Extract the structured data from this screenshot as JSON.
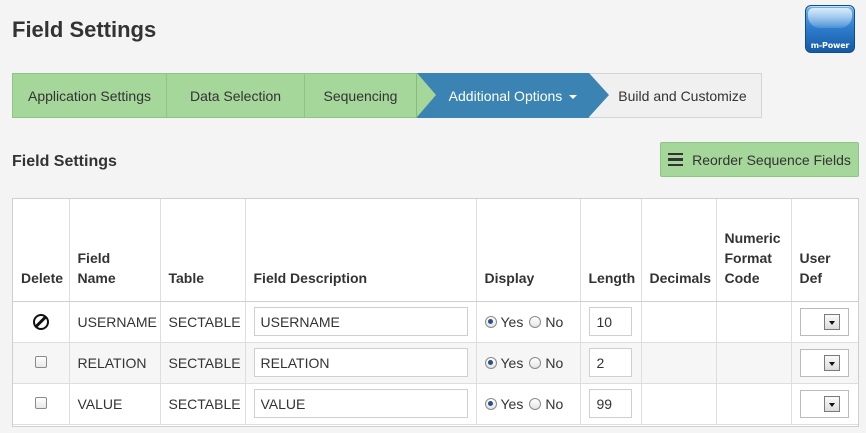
{
  "page": {
    "title": "Field Settings",
    "logo_text": "m-Power"
  },
  "wizard": {
    "steps": [
      {
        "label": "Application Settings",
        "state": "done"
      },
      {
        "label": "Data Selection",
        "state": "done"
      },
      {
        "label": "Sequencing",
        "state": "done"
      },
      {
        "label": "Additional Options",
        "state": "active"
      },
      {
        "label": "Build and Customize",
        "state": "todo"
      }
    ]
  },
  "section": {
    "title": "Field Settings",
    "reorder_label": "Reorder Sequence Fields"
  },
  "table": {
    "headers": {
      "delete": "Delete",
      "field_name": "Field Name",
      "table": "Table",
      "field_description": "Field Description",
      "display": "Display",
      "length": "Length",
      "decimals": "Decimals",
      "numeric_format": "Numeric Format Code",
      "user_def": "User Def"
    },
    "display_yes": "Yes",
    "display_no": "No",
    "rows": [
      {
        "delete": "disabled",
        "field_name": "USERNAME",
        "table": "SECTABLE",
        "description": "USERNAME",
        "display": "Yes",
        "length": "10",
        "decimals": "",
        "numeric_format": "",
        "user_def": ""
      },
      {
        "delete": "checkbox",
        "field_name": "RELATION",
        "table": "SECTABLE",
        "description": "RELATION",
        "display": "Yes",
        "length": "2",
        "decimals": "",
        "numeric_format": "",
        "user_def": ""
      },
      {
        "delete": "checkbox",
        "field_name": "VALUE",
        "table": "SECTABLE",
        "description": "VALUE",
        "display": "Yes",
        "length": "99",
        "decimals": "",
        "numeric_format": "",
        "user_def": ""
      }
    ]
  },
  "colors": {
    "step_done": "#a5d69a",
    "step_active": "#3b83b3",
    "step_todo": "#f0f0f0",
    "background": "#f4f4f4"
  }
}
